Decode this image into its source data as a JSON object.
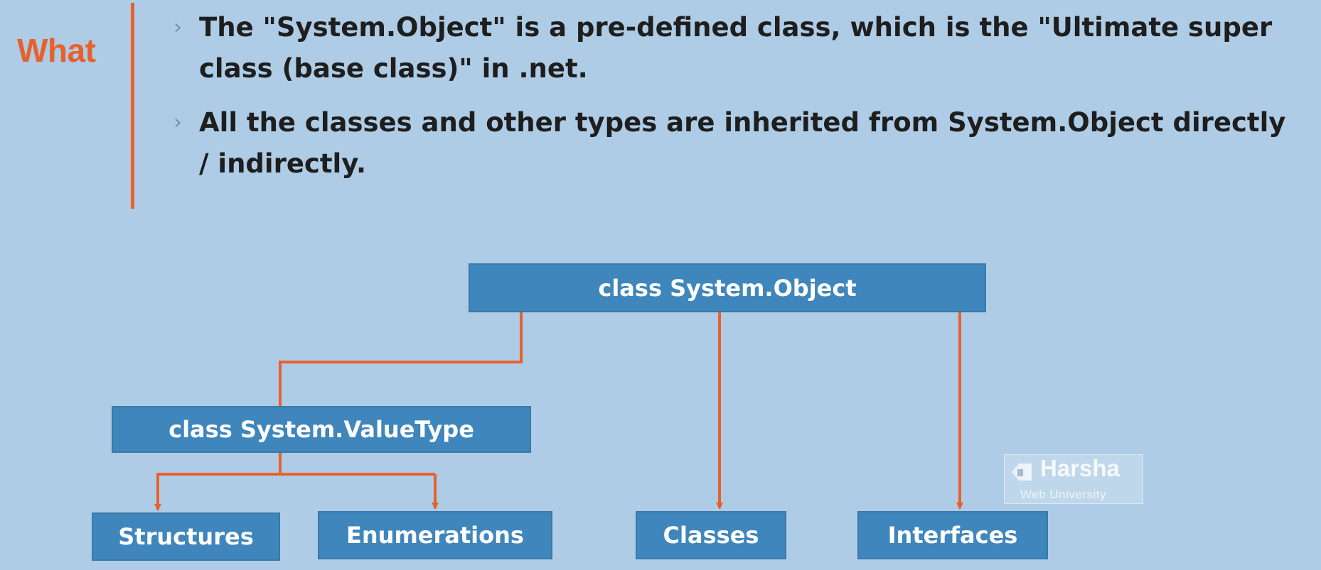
{
  "header": {
    "label": "What"
  },
  "bullets": [
    {
      "lines": [
        "The \"System.Object\" is a pre-defined class, which is the \"Ultimate super",
        "class (base class)\" in .net."
      ]
    },
    {
      "lines": [
        "All the classes and other types are inherited from System.Object directly",
        "/ indirectly."
      ]
    }
  ],
  "bullet_marker": "›",
  "diagram": {
    "nodes": {
      "object": "class System.Object",
      "valuetype": "class System.ValueType",
      "structures": "Structures",
      "enumerations": "Enumerations",
      "classes": "Classes",
      "interfaces": "Interfaces"
    },
    "edges": [
      {
        "from": "object",
        "to": "valuetype"
      },
      {
        "from": "object",
        "to": "classes"
      },
      {
        "from": "object",
        "to": "interfaces"
      },
      {
        "from": "valuetype",
        "to": "structures"
      },
      {
        "from": "valuetype",
        "to": "enumerations"
      }
    ]
  },
  "watermark": {
    "name": "Harsha",
    "subtitle": "Web University"
  },
  "colors": {
    "background": "#aecce5",
    "accent": "#e8612c",
    "box_fill": "#3f86bc",
    "box_text": "#ffffff"
  }
}
